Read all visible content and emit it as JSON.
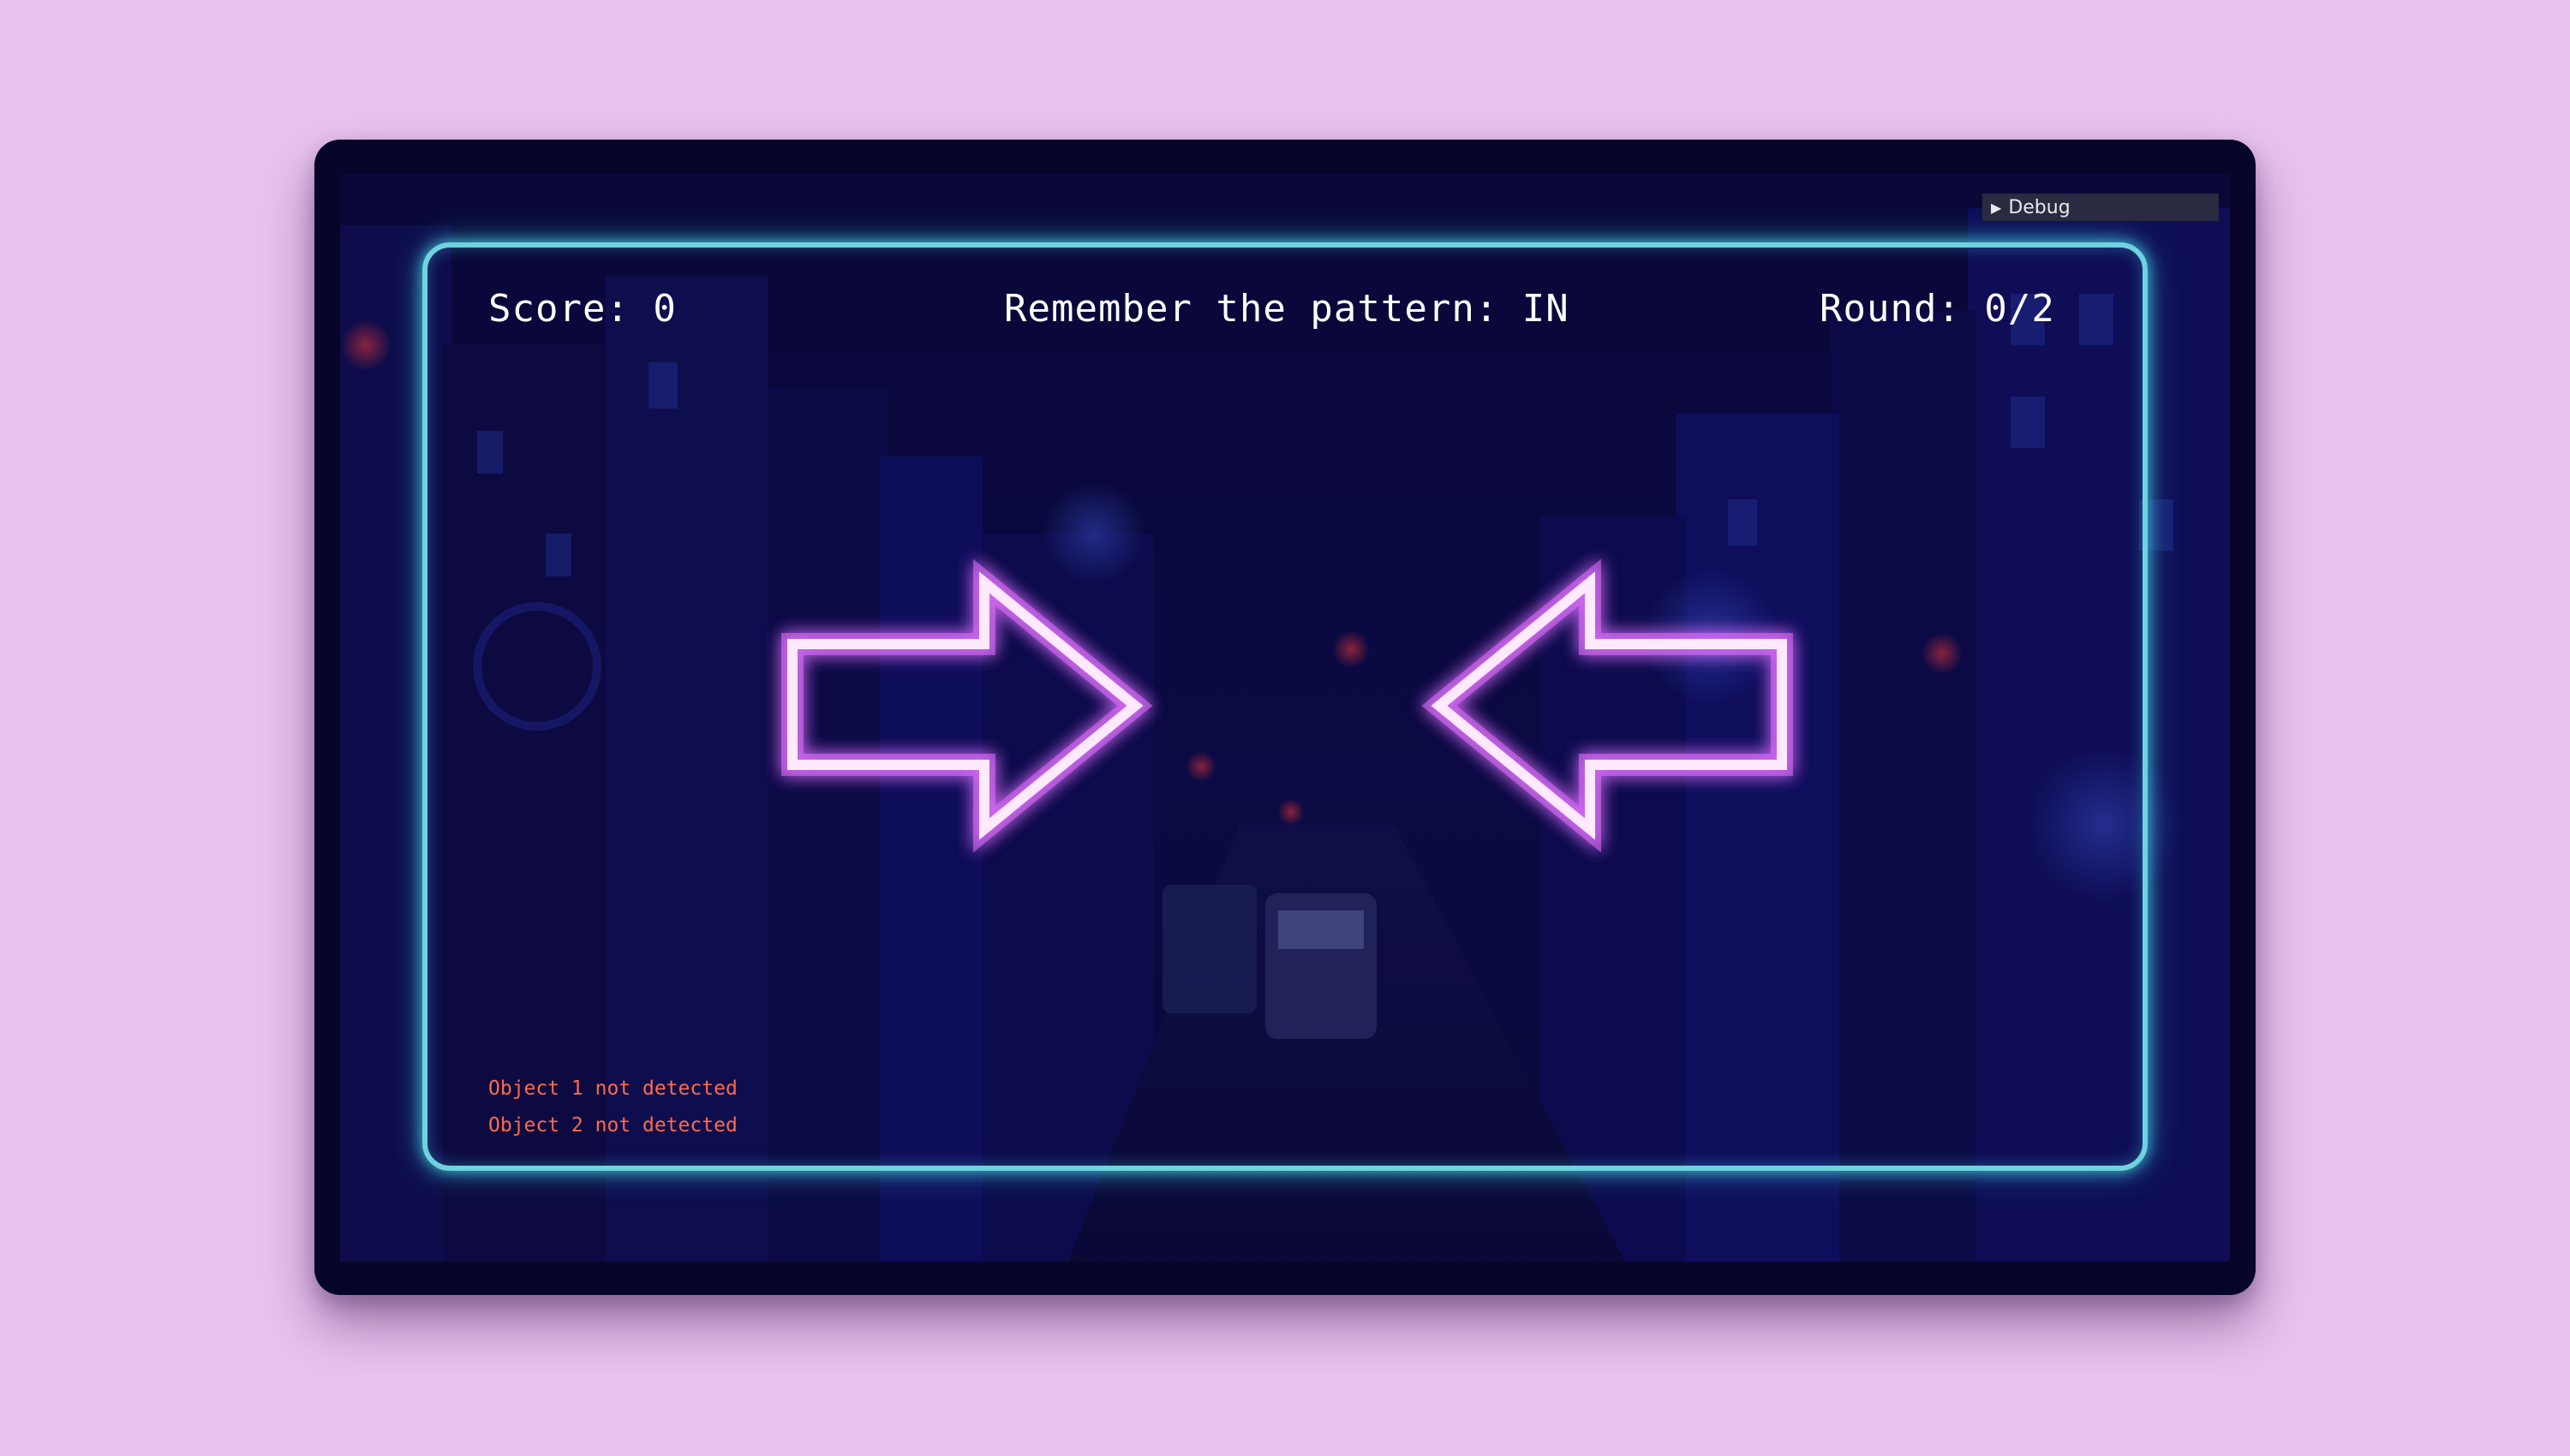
{
  "debug_panel": {
    "label": "Debug",
    "state": "collapsed"
  },
  "hud": {
    "score_text": "Score: 0",
    "prompt_text": "Remember the pattern: IN",
    "round_text": "Round: 0/2"
  },
  "pattern": {
    "value": "IN",
    "arrows": [
      {
        "name": "left-arrow",
        "direction": "right"
      },
      {
        "name": "right-arrow",
        "direction": "left"
      }
    ],
    "arrow_color": "#ffe9ff",
    "glow_color": "#e070ff"
  },
  "frame_color": "#6fd3df",
  "detection_status": [
    {
      "text": "Object 1 not detected"
    },
    {
      "text": "Object 2 not detected"
    }
  ],
  "status_color": "#ff6a4a",
  "background": {
    "description_color": "#0d0b4a",
    "page_color": "#e8c3ee"
  }
}
